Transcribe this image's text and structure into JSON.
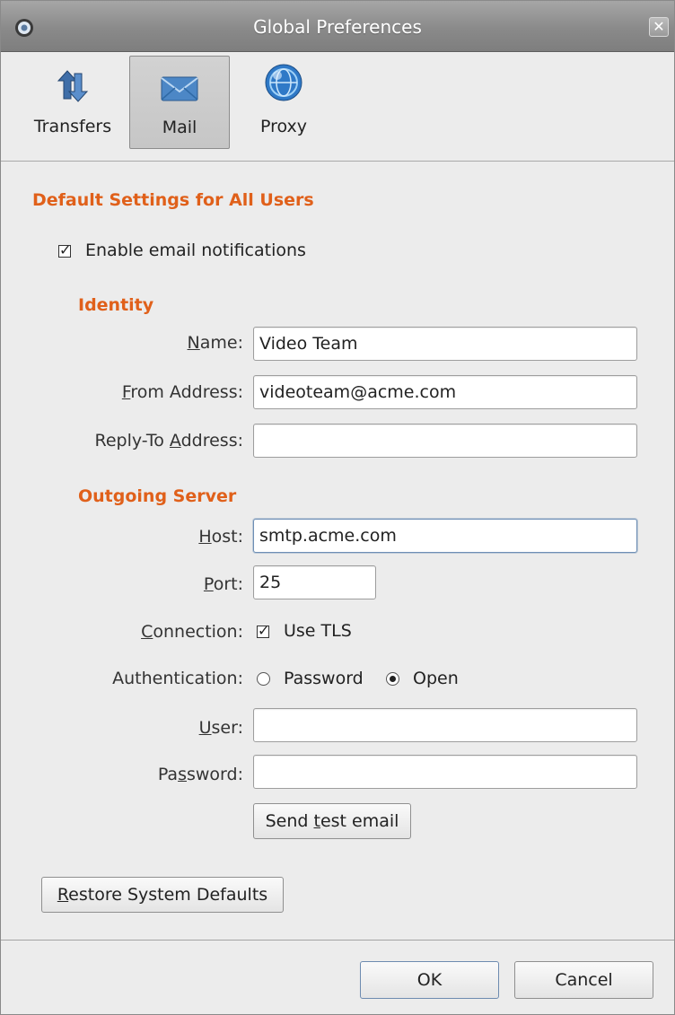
{
  "window": {
    "title": "Global Preferences",
    "close_symbol": "✕"
  },
  "toolbar": {
    "items": [
      {
        "label": "Transfers",
        "icon": "transfer-arrows-icon",
        "selected": false
      },
      {
        "label": "Mail",
        "icon": "envelope-icon",
        "selected": true
      },
      {
        "label": "Proxy",
        "icon": "globe-icon",
        "selected": false
      }
    ]
  },
  "mail": {
    "section_title": "Default Settings for All Users",
    "enable_notifications": {
      "label": "Enable email notifications",
      "checked": true
    },
    "identity": {
      "title": "Identity",
      "name_label": {
        "pre": "",
        "key": "N",
        "post": "ame:"
      },
      "name_value": "Video Team",
      "from_label": {
        "pre": "",
        "key": "F",
        "post": "rom Address:"
      },
      "from_value": "videoteam@acme.com",
      "reply_label": {
        "pre": "Reply-To ",
        "key": "A",
        "post": "ddress:"
      },
      "reply_value": ""
    },
    "server": {
      "title": "Outgoing Server",
      "host_label": {
        "pre": "",
        "key": "H",
        "post": "ost:"
      },
      "host_value": "smtp.acme.com",
      "port_label": {
        "pre": "",
        "key": "P",
        "post": "ort:"
      },
      "port_value": "25",
      "connection_label": {
        "pre": "",
        "key": "C",
        "post": "onnection:"
      },
      "tls": {
        "label": "Use TLS",
        "checked": true
      },
      "auth_label": "Authentication:",
      "auth_options": [
        {
          "label": "Password",
          "selected": false
        },
        {
          "label": "Open",
          "selected": true
        }
      ],
      "user_label": {
        "pre": "",
        "key": "U",
        "post": "ser:"
      },
      "user_value": "",
      "password_label": {
        "pre": "Pa",
        "key": "s",
        "post": "sword:"
      },
      "password_value": "",
      "test_button": {
        "pre": "Send ",
        "key": "t",
        "post": "est email"
      }
    },
    "restore_button": {
      "pre": "",
      "key": "R",
      "post": "estore System Defaults"
    }
  },
  "footer": {
    "ok_label": "OK",
    "cancel_label": "Cancel"
  },
  "colors": {
    "section_title": "#e0601a",
    "titlebar": "#8a8a8a"
  }
}
